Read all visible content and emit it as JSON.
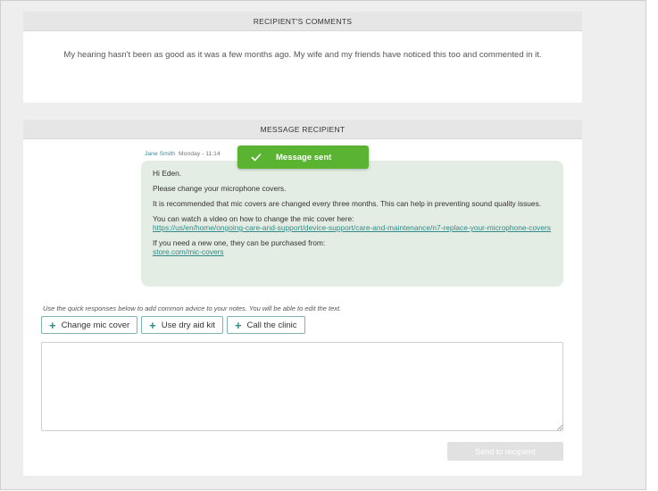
{
  "comments": {
    "header": "RECIPIENT'S COMMENTS",
    "text": "My hearing hasn't been as good as it was a few months ago. My wife and my friends have noticed this too and commented in it."
  },
  "message": {
    "header": "MESSAGE RECIPIENT",
    "sender": "Jane Smith",
    "time": "Monday - 11:14",
    "toast": "Message sent",
    "body": {
      "greeting": "Hi Eden.",
      "line1": "Please change your microphone covers.",
      "line2": "It is recommended that mic covers are changed every three months. This can help in preventing sound quality issues.",
      "line3": "You can watch a video on how to change the mic cover here:",
      "link1": "https://us/en/home/ongoing-care-and-support/device-support/care-and-maintenance/n7-replace-your-microphone-covers",
      "line4": "If you need a new one, they can be purchased from:",
      "link2": "store.com/mic-covers"
    },
    "hint": "Use the quick responses below to add common advice to your notes. You will be able to edit the text.",
    "quick_responses": [
      "Change mic cover",
      "Use dry aid kit",
      "Call the clinic"
    ],
    "notes_value": "",
    "send_label": "Send to recipient"
  },
  "colors": {
    "toast": "#5ab432",
    "accent": "#2f8a89",
    "bubble": "#e4ede3"
  }
}
